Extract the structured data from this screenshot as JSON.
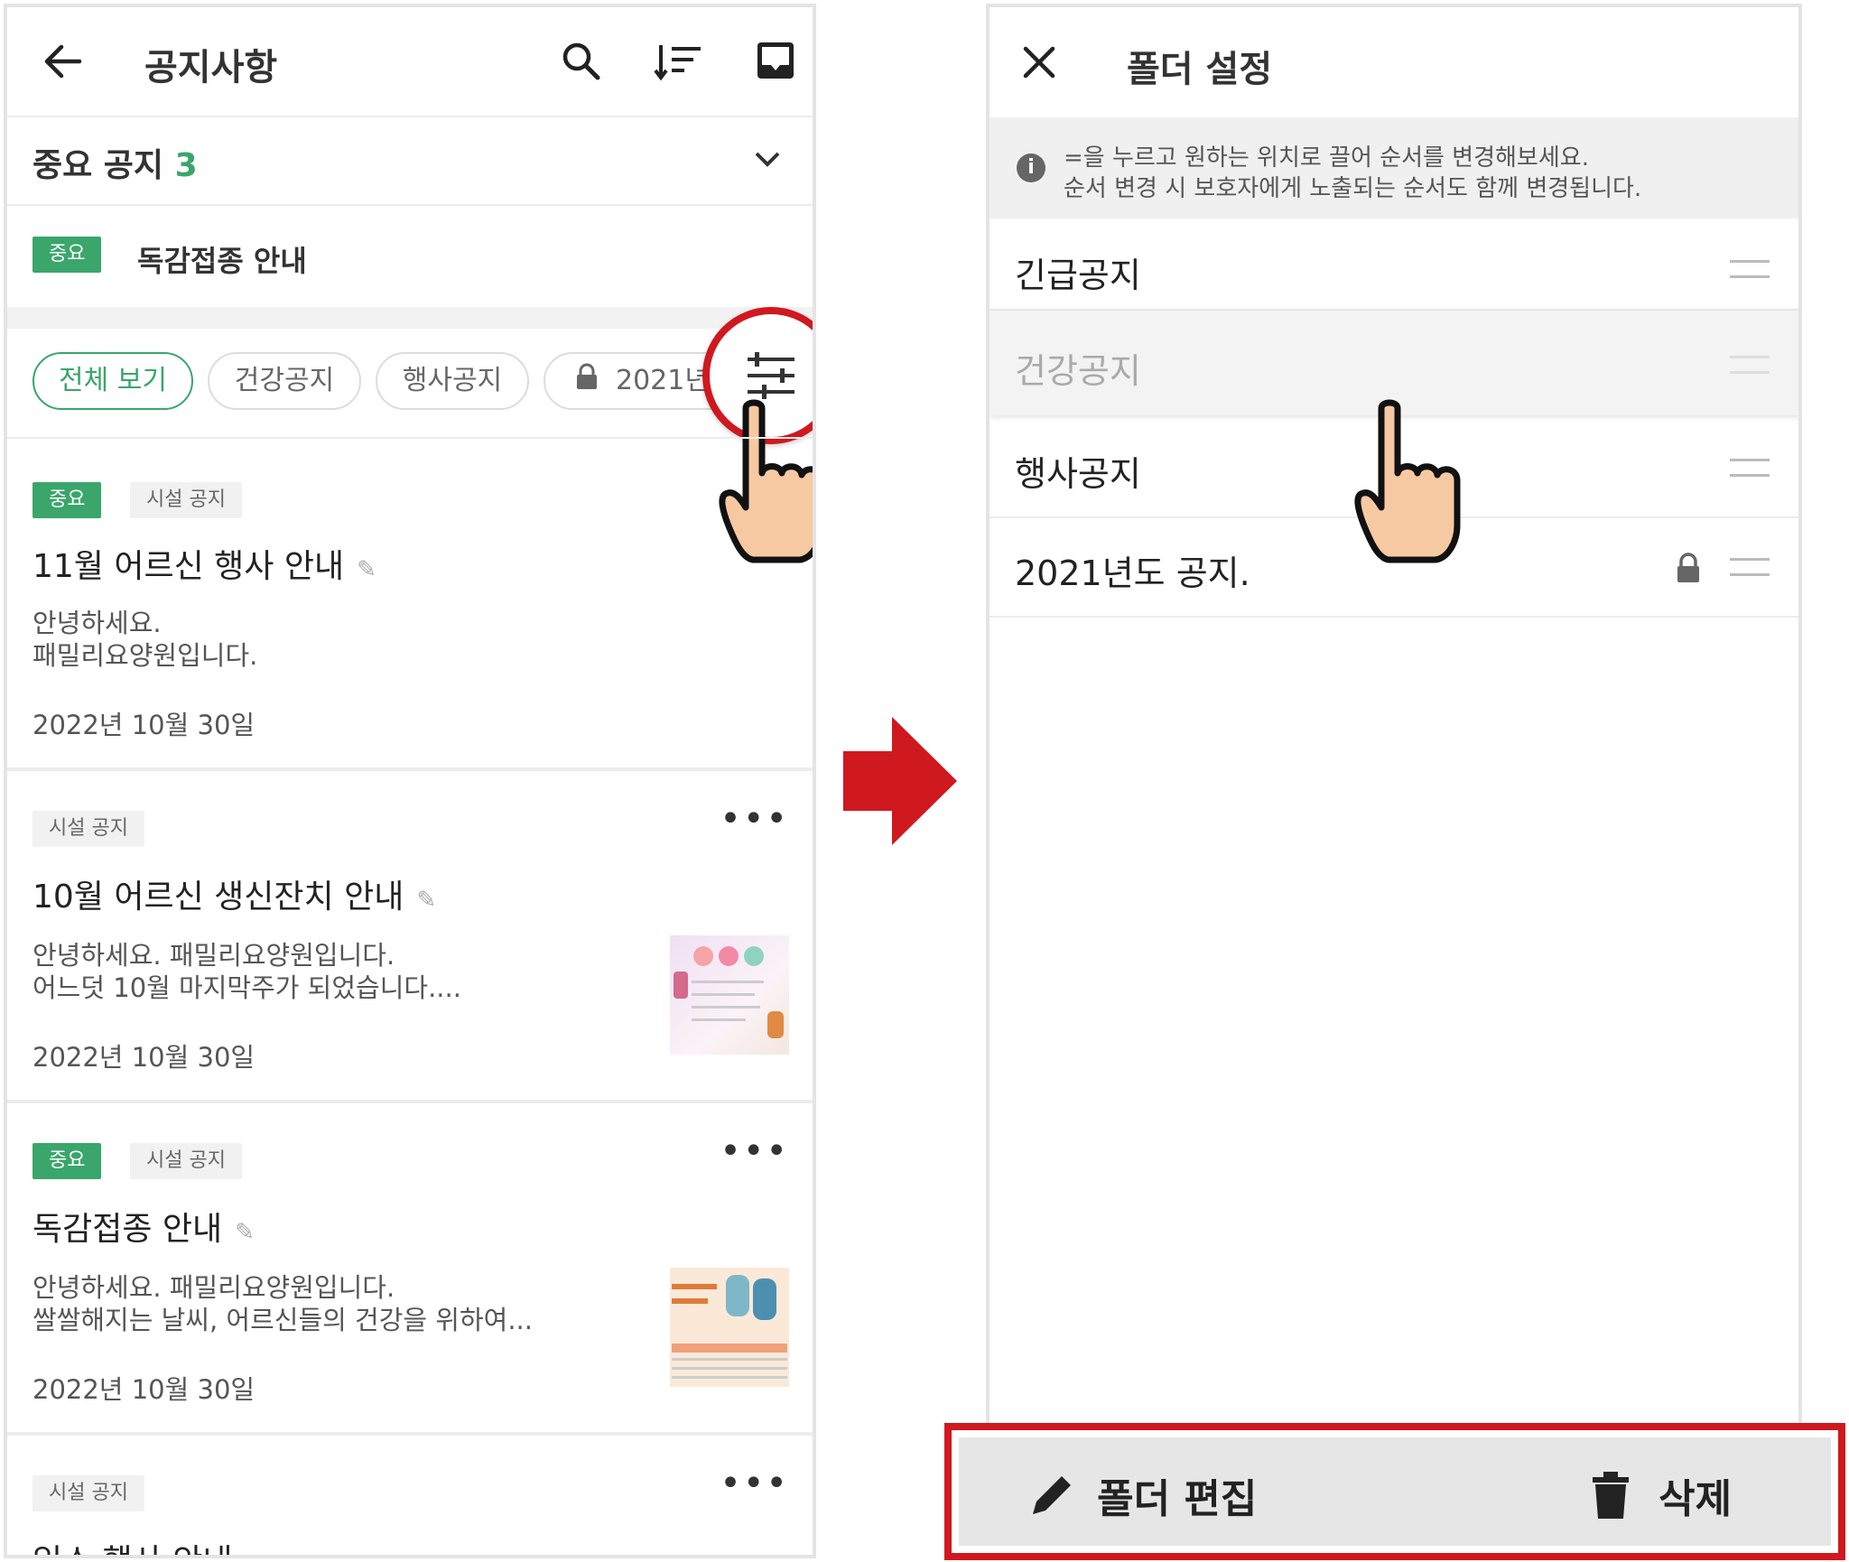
{
  "left": {
    "header": {
      "title": "공지사항",
      "back_icon": "arrow-left-icon",
      "search_icon": "search-icon",
      "sort_icon": "sort-icon",
      "inbox_icon": "inbox-icon"
    },
    "important_section": {
      "label": "중요 공지",
      "count": "3"
    },
    "pinned": {
      "tag": "중요",
      "title": "독감접종 안내"
    },
    "chips": [
      {
        "label": "전체 보기"
      },
      {
        "label": "건강공지"
      },
      {
        "label": "행사공지"
      },
      {
        "label": "2021년"
      }
    ],
    "posts": [
      {
        "tags": [
          "중요",
          "시설 공지"
        ],
        "title": "11월 어르신 행사 안내",
        "body": [
          "안녕하세요.",
          "패밀리요양원입니다."
        ],
        "date": "2022년 10월 30일"
      },
      {
        "tags": [
          "시설 공지"
        ],
        "title": "10월 어르신 생신잔치 안내",
        "body": [
          "안녕하세요. 패밀리요양원입니다.",
          "어느덧 10월 마지막주가 되었습니다...."
        ],
        "date": "2022년 10월 30일"
      },
      {
        "tags": [
          "중요",
          "시설 공지"
        ],
        "title": "독감접종 안내",
        "body": [
          "안녕하세요. 패밀리요양원입니다.",
          "쌀쌀해지는 날씨, 어르신들의 건강을 위하여..."
        ],
        "date": "2022년 10월 30일"
      },
      {
        "tags": [
          "시설 공지"
        ],
        "title": "입소 행사 안내"
      }
    ]
  },
  "right": {
    "header": {
      "title": "폴더 설정",
      "close_icon": "close-icon"
    },
    "info": {
      "line1": "=을 누르고 원하는 위치로 끌어 순서를 변경해보세요.",
      "line2": "순서 변경 시 보호자에게 노출되는 순서도 함께 변경됩니다."
    },
    "folders": [
      {
        "label": "긴급공지"
      },
      {
        "label": "건강공지"
      },
      {
        "label": "행사공지"
      },
      {
        "label": "2021년도 공지."
      }
    ],
    "bottom": {
      "edit_label": "폴더 편집",
      "delete_label": "삭제"
    }
  },
  "colors": {
    "accent_green": "#3aa66b",
    "highlight_red": "#d0181f",
    "bottom_bar": "#e6e6e6"
  }
}
